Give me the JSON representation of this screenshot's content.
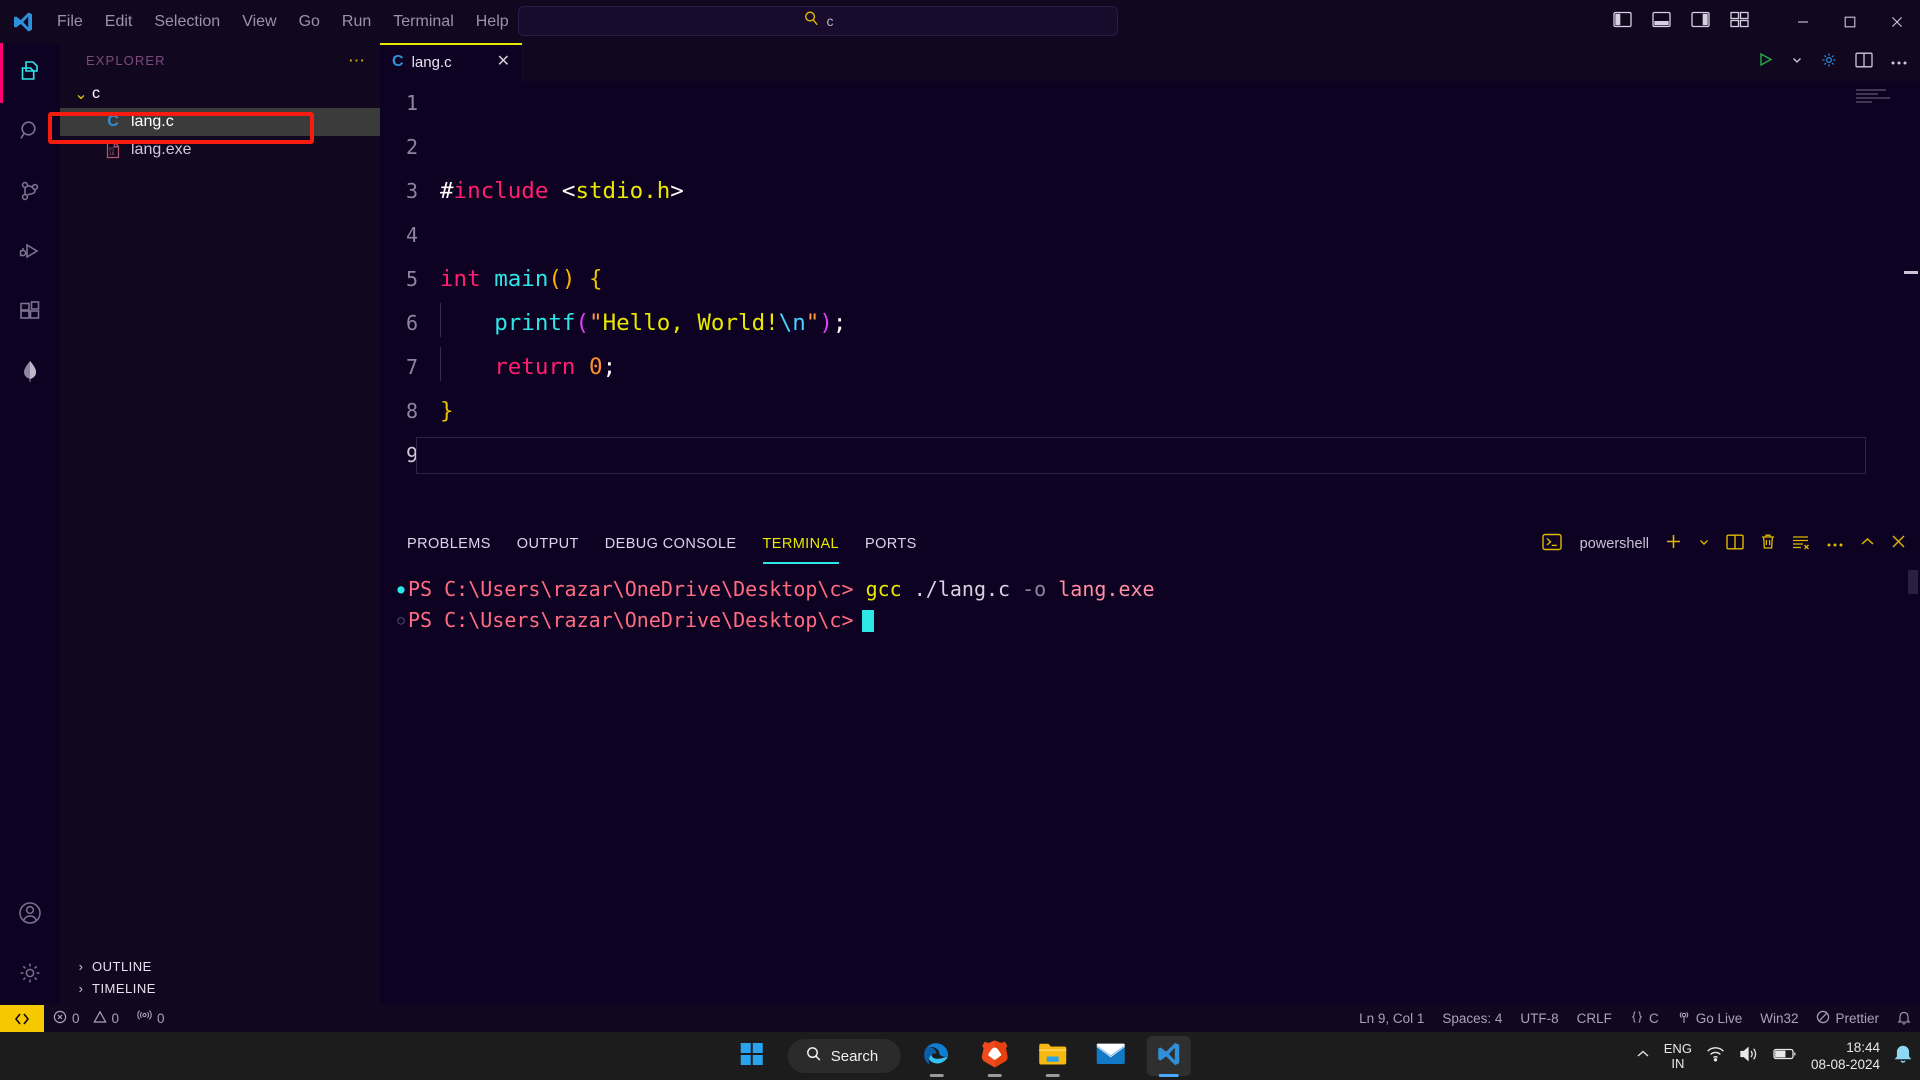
{
  "titlebar": {
    "menu": [
      "File",
      "Edit",
      "Selection",
      "View",
      "Go",
      "Run",
      "Terminal",
      "Help"
    ],
    "back_icon": "arrow-left-icon",
    "forward_icon": "arrow-right-icon",
    "search": {
      "icon": "search-icon",
      "value": "c",
      "placeholder": ""
    },
    "layout_icons": [
      "toggle-primary-sidebar-icon",
      "toggle-panel-icon",
      "toggle-secondary-sidebar-icon",
      "customize-layout-icon"
    ],
    "window": {
      "minimize": "─",
      "maximize": "☐",
      "close": "✕"
    }
  },
  "activitybar": {
    "items": [
      {
        "name": "explorer",
        "icon": "files-icon",
        "active": true
      },
      {
        "name": "search",
        "icon": "search-icon",
        "active": false
      },
      {
        "name": "source-control",
        "icon": "source-control-icon",
        "active": false
      },
      {
        "name": "run-and-debug",
        "icon": "debug-icon",
        "active": false
      },
      {
        "name": "extensions",
        "icon": "extensions-icon",
        "active": false
      },
      {
        "name": "mongodb",
        "icon": "leaf-icon",
        "active": false
      }
    ],
    "bottom": [
      {
        "name": "accounts",
        "icon": "account-icon"
      },
      {
        "name": "manage",
        "icon": "gear-icon"
      }
    ]
  },
  "sidebar": {
    "title": "EXPLORER",
    "more_actions": "⋯",
    "folder": {
      "label": "c",
      "expanded": true,
      "chevron": "⌄"
    },
    "files": [
      {
        "label": "lang.c",
        "icon": "c-file-icon",
        "selected": true
      },
      {
        "label": "lang.exe",
        "icon": "binary-file-icon",
        "selected": false,
        "highlighted": true
      }
    ],
    "sections": [
      {
        "label": "OUTLINE",
        "chevron": "›"
      },
      {
        "label": "TIMELINE",
        "chevron": "›"
      }
    ],
    "annotation_color": "#f81b0f"
  },
  "editor": {
    "tab": {
      "label": "lang.c",
      "icon": "c-file-icon",
      "close": "✕",
      "active": true
    },
    "actions": [
      "run-icon",
      "run-dropdown-icon",
      "settings-gear-icon",
      "split-editor-icon",
      "more-actions-icon"
    ],
    "lines": [
      {
        "number": "1",
        "tokens": []
      },
      {
        "number": "2",
        "tokens": []
      },
      {
        "number": "3",
        "tokens": [
          {
            "t": "#",
            "c": "s-hash"
          },
          {
            "t": "include",
            "c": "s-incl"
          },
          {
            "t": " ",
            "c": "s-punc"
          },
          {
            "t": "<",
            "c": "s-angle"
          },
          {
            "t": "stdio.h",
            "c": "s-hdr"
          },
          {
            "t": ">",
            "c": "s-angle"
          }
        ]
      },
      {
        "number": "4",
        "tokens": []
      },
      {
        "number": "5",
        "tokens": [
          {
            "t": "int",
            "c": "s-kw"
          },
          {
            "t": " ",
            "c": "s-punc"
          },
          {
            "t": "main",
            "c": "s-fn"
          },
          {
            "t": "()",
            "c": "s-paren"
          },
          {
            "t": " ",
            "c": "s-punc"
          },
          {
            "t": "{",
            "c": "s-brace"
          }
        ]
      },
      {
        "number": "6",
        "indent": true,
        "tokens": [
          {
            "t": "    ",
            "c": "s-punc"
          },
          {
            "t": "printf",
            "c": "s-fn"
          },
          {
            "t": "(",
            "c": "s-paren2"
          },
          {
            "t": "\"",
            "c": "s-quote"
          },
          {
            "t": "Hello, World!",
            "c": "s-str"
          },
          {
            "t": "\\n",
            "c": "s-esc"
          },
          {
            "t": "\"",
            "c": "s-quote"
          },
          {
            "t": ")",
            "c": "s-paren2"
          },
          {
            "t": ";",
            "c": "s-punc"
          }
        ]
      },
      {
        "number": "7",
        "indent": true,
        "tokens": [
          {
            "t": "    ",
            "c": "s-punc"
          },
          {
            "t": "return",
            "c": "s-kw"
          },
          {
            "t": " ",
            "c": "s-punc"
          },
          {
            "t": "0",
            "c": "s-num"
          },
          {
            "t": ";",
            "c": "s-punc"
          }
        ]
      },
      {
        "number": "8",
        "tokens": [
          {
            "t": "}",
            "c": "s-brace"
          }
        ]
      },
      {
        "number": "9",
        "current": true,
        "tokens": []
      }
    ]
  },
  "panel": {
    "tabs": [
      {
        "label": "PROBLEMS",
        "active": false
      },
      {
        "label": "OUTPUT",
        "active": false
      },
      {
        "label": "DEBUG CONSOLE",
        "active": false
      },
      {
        "label": "TERMINAL",
        "active": true
      },
      {
        "label": "PORTS",
        "active": false
      }
    ],
    "shell": {
      "icon": "powershell-icon",
      "label": "powershell"
    },
    "actions": [
      "new-terminal-icon",
      "terminal-dropdown-icon",
      "split-terminal-icon",
      "kill-terminal-icon",
      "clear-terminal-icon",
      "more-actions-icon",
      "maximize-panel-icon",
      "close-panel-icon"
    ],
    "terminal_lines": [
      {
        "status": "success",
        "prompt": "PS C:\\Users\\razar\\OneDrive\\Desktop\\c>",
        "segments": [
          {
            "t": " gcc",
            "c": "t-cmd"
          },
          {
            "t": " ./lang.c",
            "c": "t-arg"
          },
          {
            "t": " -o",
            "c": "t-flag"
          },
          {
            "t": " lang.exe",
            "c": "t-out"
          }
        ],
        "cursor": false
      },
      {
        "status": "idle",
        "prompt": "PS C:\\Users\\razar\\OneDrive\\Desktop\\c>",
        "segments": [],
        "cursor": true
      }
    ]
  },
  "statusbar": {
    "remote": "≈",
    "left": [
      {
        "name": "errors",
        "icon": "error-icon",
        "value": "0"
      },
      {
        "name": "warnings",
        "icon": "warning-icon",
        "value": "0"
      },
      {
        "name": "ports",
        "icon": "radio-tower-icon",
        "value": "0"
      }
    ],
    "right": [
      {
        "name": "cursor-position",
        "value": "Ln 9, Col 1"
      },
      {
        "name": "indentation",
        "value": "Spaces: 4"
      },
      {
        "name": "encoding",
        "value": "UTF-8"
      },
      {
        "name": "eol",
        "value": "CRLF"
      },
      {
        "name": "language-mode",
        "icon": "braces-icon",
        "value": "C"
      },
      {
        "name": "go-live",
        "icon": "broadcast-icon",
        "value": "Go Live"
      },
      {
        "name": "platform",
        "value": "Win32"
      },
      {
        "name": "prettier",
        "icon": "no-entry-icon",
        "value": "Prettier"
      },
      {
        "name": "notifications",
        "icon": "bell-icon",
        "value": ""
      }
    ]
  },
  "taskbar": {
    "start": "windows-logo-icon",
    "search": {
      "icon": "search-icon",
      "label": "Search"
    },
    "apps": [
      {
        "name": "microsoft-edge",
        "icon": "edge-icon",
        "running": true
      },
      {
        "name": "brave-browser",
        "icon": "brave-icon",
        "running": true
      },
      {
        "name": "file-explorer",
        "icon": "folder-icon",
        "running": true
      },
      {
        "name": "mail",
        "icon": "mail-icon",
        "running": false
      },
      {
        "name": "visual-studio-code",
        "icon": "vscode-icon",
        "running": true,
        "active": true
      }
    ],
    "tray": {
      "overflow": "chevron-up-icon",
      "language": {
        "line1": "ENG",
        "line2": "IN"
      },
      "wifi": "wifi-icon",
      "volume": "volume-icon",
      "battery": "battery-icon",
      "time": "18:44",
      "date": "08-08-2024",
      "notification": "bell-icon"
    }
  }
}
